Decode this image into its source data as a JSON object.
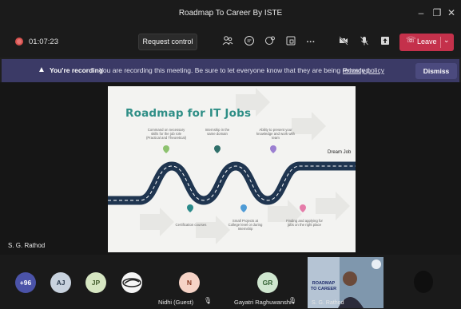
{
  "window": {
    "title": "Roadmap To Career By ISTE"
  },
  "toolbar": {
    "timer": "01:07:23",
    "request_control_label": "Request control",
    "leave_label": "Leave"
  },
  "banner": {
    "bold_text": "You're recording",
    "message": "You are recording this meeting. Be sure to let everyone know that they are being recorded.",
    "policy_link": "Privacy policy",
    "dismiss_label": "Dismiss"
  },
  "slide": {
    "title": "Roadmap for IT Jobs",
    "notes_top": [
      "Command on necessary skills for the job role (Practical and Theoretical)",
      "Internship in the same domain",
      "Ability to present your knowledge and work with team"
    ],
    "notes_bottom": [
      "Certification courses",
      "Small Projects at College level or during Internship",
      "Finding and applying for jobs on the right place"
    ],
    "goal": "Dream Job"
  },
  "presenter_name": "S. G. Rathod",
  "participants": {
    "overflow": "+96",
    "items": [
      {
        "initials": "AJ"
      },
      {
        "initials": "JP"
      },
      {
        "initials": "N",
        "name": "Nidhi (Guest)"
      },
      {
        "initials": "GR",
        "name": "Gayatri Raghuwanshi"
      }
    ],
    "video_name": "S. G. Rathod",
    "video_caption": "ROADMAP TO CAREER"
  },
  "colors": {
    "leave": "#c4314b",
    "banner": "#3b3a66",
    "slide_title": "#2e8e86",
    "road": "#1f3550"
  }
}
